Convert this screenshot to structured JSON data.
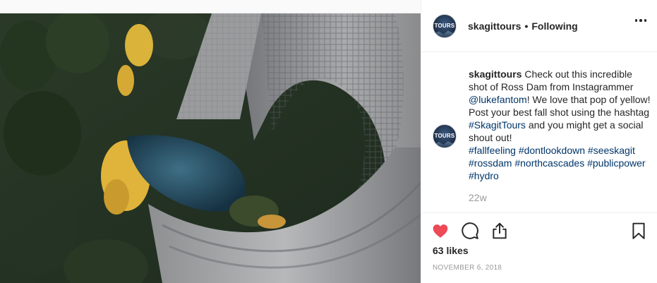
{
  "post": {
    "photo_alt": "Ross Dam",
    "account": {
      "username": "skagittours",
      "follow_status": "Following",
      "avatar_text": "TOURS"
    },
    "caption": {
      "username": "skagittours",
      "text_before_mention": " Check out this incredible shot of Ross Dam from Instagrammer ",
      "mention": "@lukefantom",
      "text_after_mention": "! We love that pop of yellow! Post your best fall shot using the hashtag ",
      "inline_hashtag": "#SkagitTours",
      "text_after_hashtag": " and you might get a social shout out!",
      "hashtags": [
        "#fallfeeling",
        "#dontlookdown",
        "#seeskagit",
        "#rossdam",
        "#northcascades",
        "#publicpower",
        "#hydro"
      ]
    },
    "time_ago": "22w",
    "likes": "63 likes",
    "date": "NOVEMBER 6, 2018",
    "icons": {
      "more": "more-options-icon",
      "like": "heart-icon",
      "comment": "comment-icon",
      "share": "share-icon",
      "save": "bookmark-icon"
    },
    "colors": {
      "like_active": "#ed4956",
      "link": "#003569",
      "muted": "#999999",
      "text": "#262626"
    }
  }
}
